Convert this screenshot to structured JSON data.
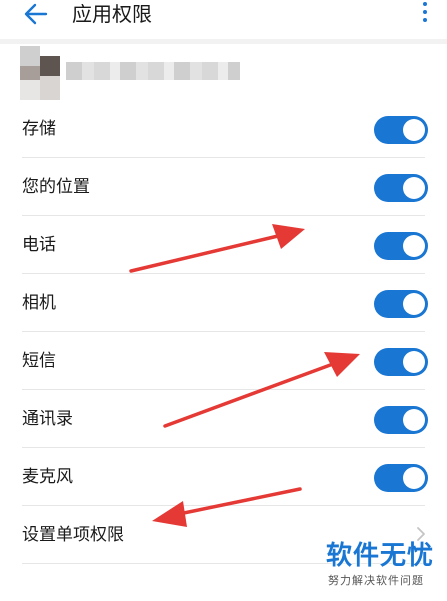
{
  "appbar": {
    "title": "应用权限",
    "back_icon": "arrow-left-icon",
    "more_icon": "more-vertical-icon"
  },
  "permissions": [
    {
      "label": "存储",
      "enabled": true
    },
    {
      "label": "您的位置",
      "enabled": true
    },
    {
      "label": "电话",
      "enabled": true
    },
    {
      "label": "相机",
      "enabled": true
    },
    {
      "label": "短信",
      "enabled": true
    },
    {
      "label": "通讯录",
      "enabled": true
    },
    {
      "label": "麦克风",
      "enabled": true
    }
  ],
  "individual_permissions": {
    "label": "设置单项权限",
    "icon": "chevron-right-icon"
  },
  "watermark": {
    "main": "软件无忧",
    "sub": "努力解决软件问题"
  },
  "colors": {
    "accent": "#1976d2",
    "arrow": "#e53935",
    "divider": "#e6e6e6",
    "text": "#1a1a1a"
  }
}
